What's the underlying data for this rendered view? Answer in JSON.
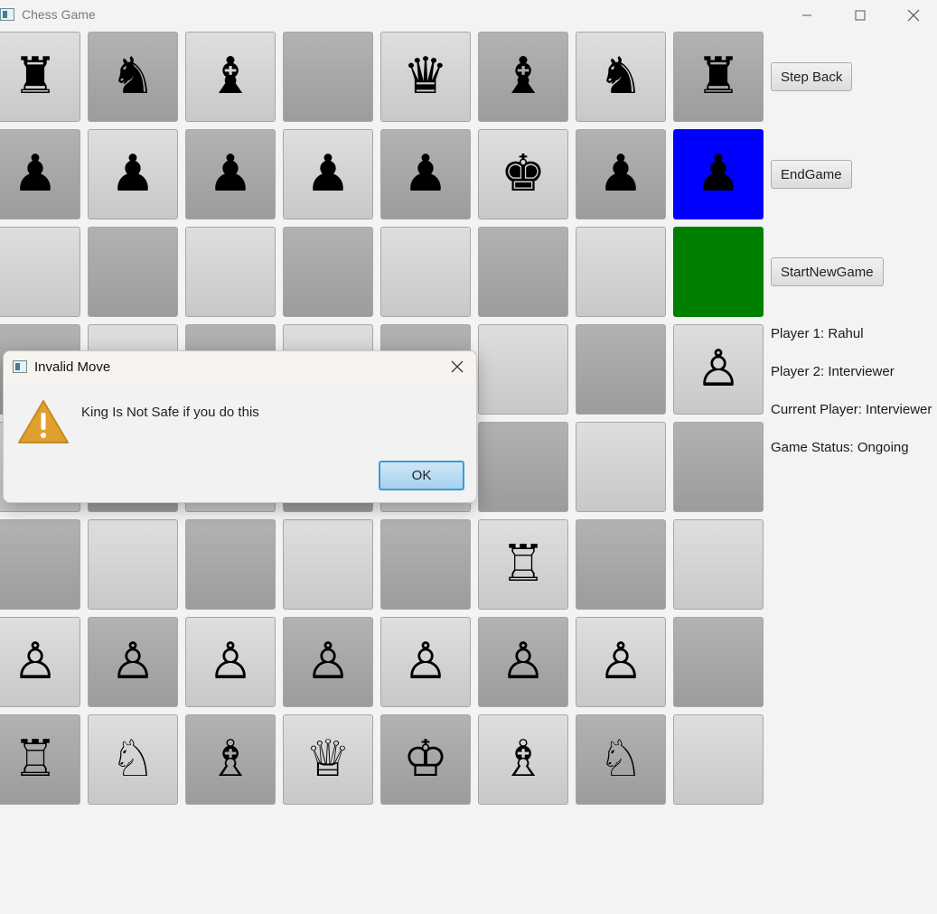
{
  "window": {
    "title": "Chess Game"
  },
  "board": {
    "rows": [
      [
        "♜",
        "♞",
        "♝",
        "",
        "♛",
        "♝",
        "♞",
        "♜"
      ],
      [
        "♟",
        "♟",
        "♟",
        "♟",
        "♟",
        "♚",
        "♟",
        "♟"
      ],
      [
        "",
        "",
        "",
        "",
        "",
        "",
        "",
        ""
      ],
      [
        "",
        "",
        "",
        "",
        "",
        "",
        "",
        "♙"
      ],
      [
        "",
        "",
        "",
        "",
        "",
        "",
        "",
        ""
      ],
      [
        "",
        "",
        "",
        "",
        "",
        "♖",
        "",
        ""
      ],
      [
        "♙",
        "♙",
        "♙",
        "♙",
        "♙",
        "♙",
        "♙",
        ""
      ],
      [
        "♖",
        "♘",
        "♗",
        "♕",
        "♔",
        "♗",
        "♘",
        ""
      ]
    ],
    "highlights": [
      {
        "row": 1,
        "col": 7,
        "color": "#0000ff"
      },
      {
        "row": 2,
        "col": 7,
        "color": "#008000"
      }
    ]
  },
  "controls": {
    "step_back": "Step Back",
    "end_game": "EndGame",
    "start_new_game": "StartNewGame"
  },
  "info": {
    "player1": "Player 1: Rahul",
    "player2": "Player 2: Interviewer",
    "current_player": "Current Player: Interviewer",
    "game_status": "Game Status: Ongoing"
  },
  "dialog": {
    "title": "Invalid Move",
    "message": "King Is Not Safe if you do this",
    "ok_label": "OK",
    "icon": "warning-icon"
  },
  "colors": {
    "highlight_selected": "#0000ff",
    "highlight_target": "#008000",
    "warning": "#e0a030"
  }
}
